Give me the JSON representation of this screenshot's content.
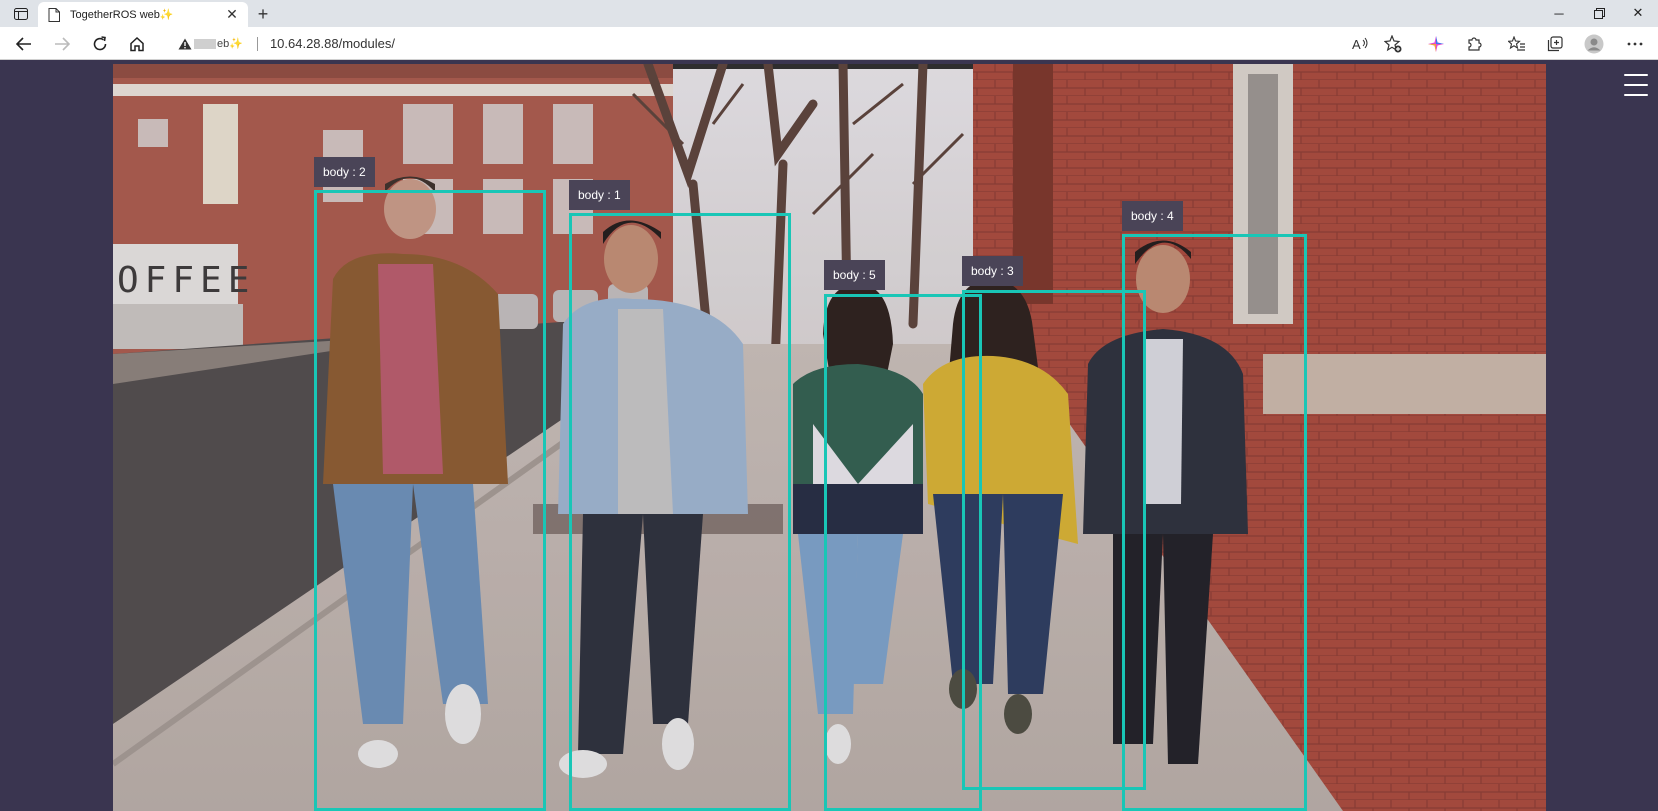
{
  "browser": {
    "tab_title": "TogetherROS web✨",
    "address_prefix": "eb✨",
    "url": "10.64.28.88/modules/"
  },
  "detections": [
    {
      "label": "body : 2"
    },
    {
      "label": "body : 1"
    },
    {
      "label": "body : 5"
    },
    {
      "label": "body : 3"
    },
    {
      "label": "body : 4"
    }
  ],
  "scene_text": {
    "storefront": "OFFEE"
  },
  "colors": {
    "box": "#19c6b6",
    "label_bg": "#4a4457",
    "page_bg": "#3a3550"
  }
}
